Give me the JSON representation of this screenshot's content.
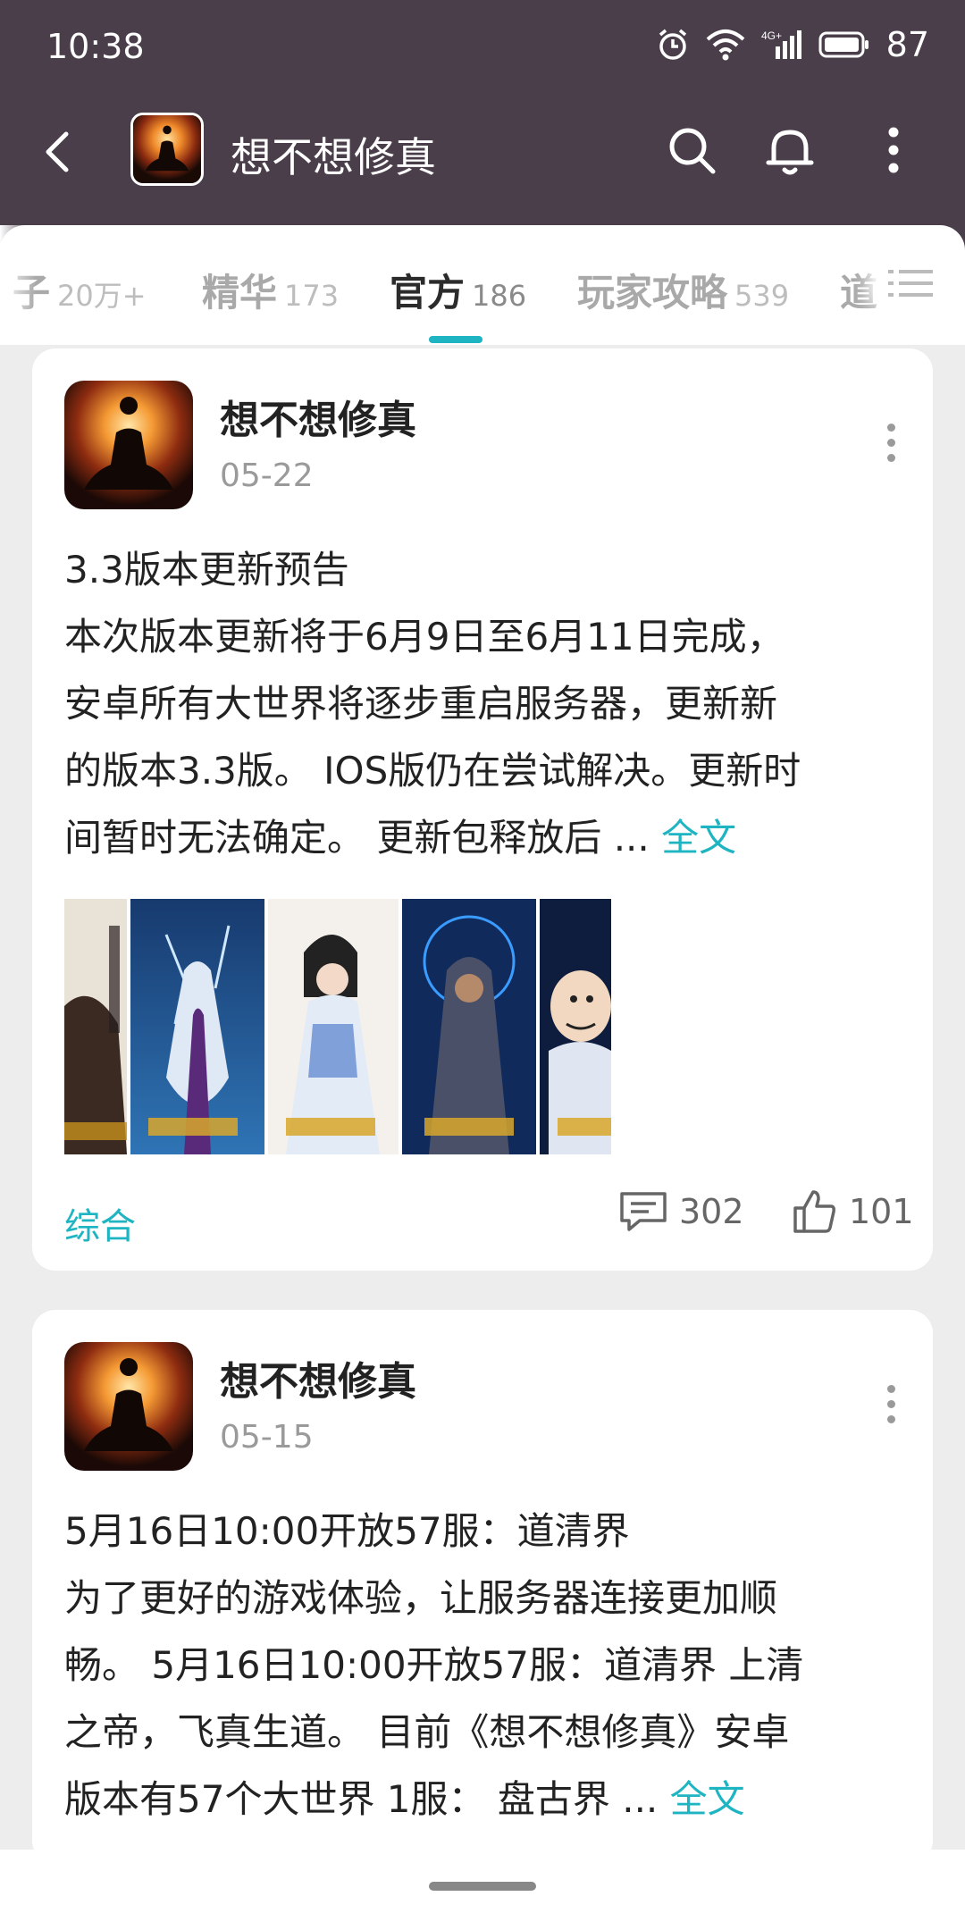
{
  "status_bar": {
    "time": "10:38",
    "network": "4G+",
    "battery": "87"
  },
  "appbar": {
    "title": "想不想修真"
  },
  "tabs": [
    {
      "label": "帖子",
      "visible_label": "子",
      "count": "20万+"
    },
    {
      "label": "精华",
      "count": "173"
    },
    {
      "label": "官方",
      "count": "186",
      "active": true
    },
    {
      "label": "玩家攻略",
      "count": "539"
    },
    {
      "label": "道",
      "count": ""
    }
  ],
  "posts": [
    {
      "author": "想不想修真",
      "date": "05-22",
      "lines": [
        "3.3版本更新预告",
        "本次版本更新将于6月9日至6月11日完成，",
        "安卓所有大世界将逐步重启服务器，更新新",
        "的版本3.3版。 IOS版仍在尝试解决。更新时",
        "间暂时无法确定。 更新包释放后 ... "
      ],
      "more_link": "全文",
      "category": "综合",
      "comments": "302",
      "likes": "101"
    },
    {
      "author": "想不想修真",
      "date": "05-15",
      "lines": [
        "5月16日10:00开放57服：道清界",
        "为了更好的游戏体验，让服务器连接更加顺",
        "畅。 5月16日10:00开放57服：道清界 上清",
        "之帝，飞真生道。 目前《想不想修真》安卓",
        "版本有57个大世界 1服： 盘古界   ... "
      ],
      "more_link": "全文"
    }
  ],
  "colors": {
    "header_bg": "#4a3e4b",
    "accent": "#1fb4c2",
    "page_bg": "#ededed"
  }
}
